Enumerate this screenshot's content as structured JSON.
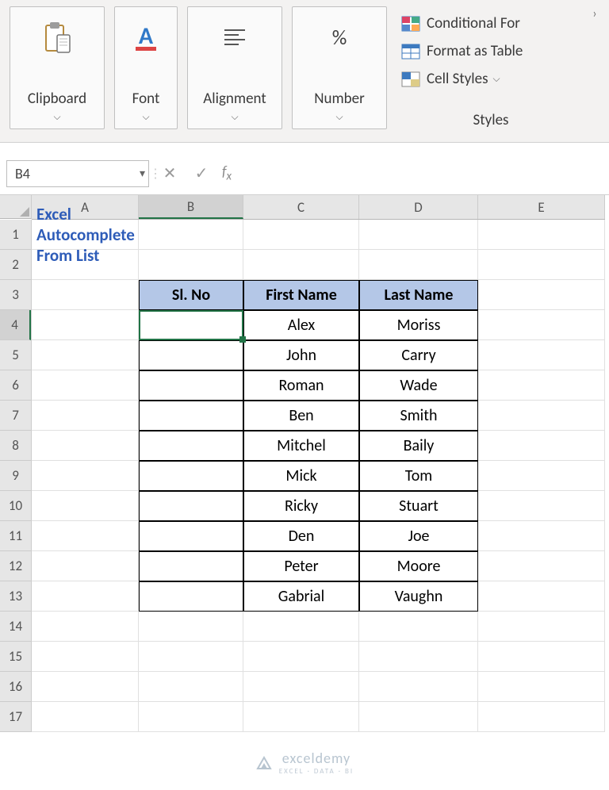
{
  "ribbon": {
    "clipboard": "Clipboard",
    "font": "Font",
    "alignment": "Alignment",
    "number": "Number",
    "styles_label": "Styles",
    "conditional": "Conditional For",
    "format_table": "Format as Table",
    "cell_styles": "Cell Styles"
  },
  "name_box": "B4",
  "columns": [
    "A",
    "B",
    "C",
    "D",
    "E"
  ],
  "rows": [
    "1",
    "2",
    "3",
    "4",
    "5",
    "6",
    "7",
    "8",
    "9",
    "10",
    "11",
    "12",
    "13",
    "14",
    "15",
    "16",
    "17"
  ],
  "active_col": "B",
  "active_row": "4",
  "title": "Excel Autocomplete From List",
  "headers": {
    "slno": "Sl. No",
    "first": "First Name",
    "last": "Last Name"
  },
  "data": [
    {
      "sl": "",
      "first": "Alex",
      "last": "Moriss"
    },
    {
      "sl": "",
      "first": "John",
      "last": "Carry"
    },
    {
      "sl": "",
      "first": "Roman",
      "last": "Wade"
    },
    {
      "sl": "",
      "first": "Ben",
      "last": "Smith"
    },
    {
      "sl": "",
      "first": "Mitchel",
      "last": "Baily"
    },
    {
      "sl": "",
      "first": "Mick",
      "last": "Tom"
    },
    {
      "sl": "",
      "first": "Ricky",
      "last": "Stuart"
    },
    {
      "sl": "",
      "first": "Den",
      "last": "Joe"
    },
    {
      "sl": "",
      "first": "Peter",
      "last": "Moore"
    },
    {
      "sl": "",
      "first": "Gabrial",
      "last": "Vaughn"
    }
  ],
  "watermark": {
    "main": "exceldemy",
    "sub": "EXCEL · DATA · BI"
  }
}
